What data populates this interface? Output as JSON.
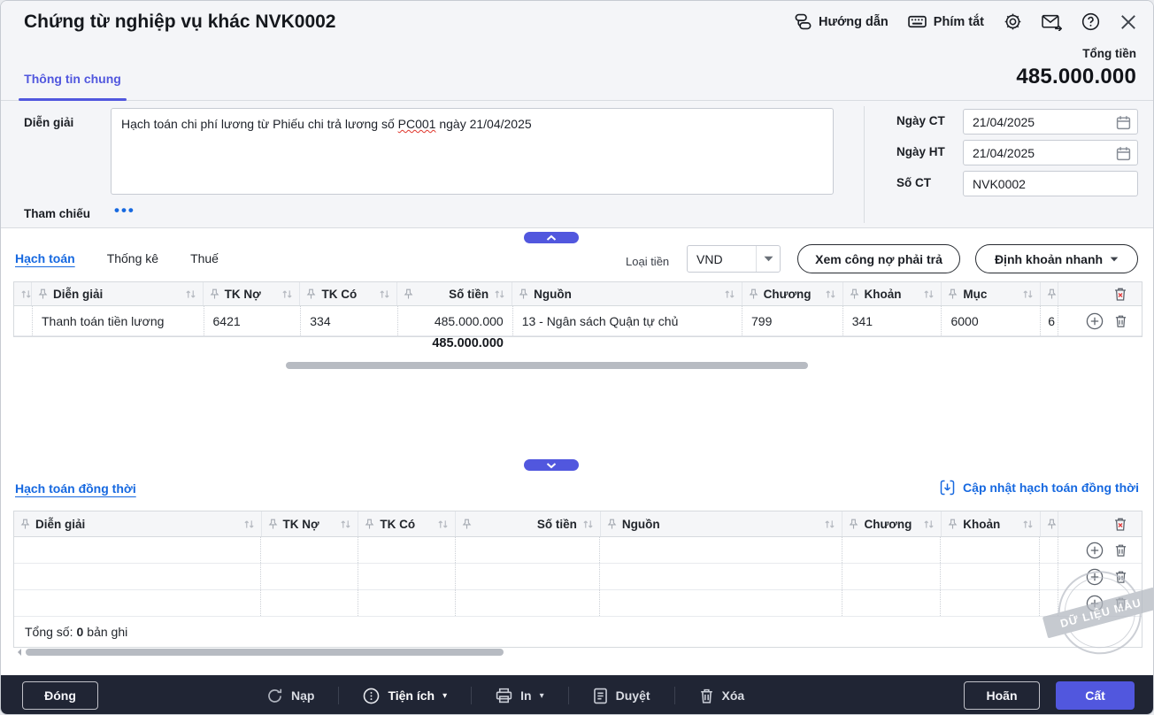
{
  "window": {
    "title": "Chứng từ nghiệp vụ khác NVK0002"
  },
  "header": {
    "guide": "Hướng dẫn",
    "shortcuts": "Phím tắt",
    "total_label": "Tổng tiền",
    "total_value": "485.000.000",
    "tab_general": "Thông tin chung"
  },
  "form": {
    "description_label": "Diễn giải",
    "description_before": "Hạch toán chi phí lương từ Phiếu chi trả lương số ",
    "description_highlight": "PC001",
    "description_after": " ngày 21/04/2025",
    "reference_label": "Tham chiếu",
    "reference_dots": "•••",
    "doc_date_label": "Ngày CT",
    "doc_date_value": "21/04/2025",
    "post_date_label": "Ngày HT",
    "post_date_value": "21/04/2025",
    "doc_no_label": "Số CT",
    "doc_no_value": "NVK0002"
  },
  "detail": {
    "tabs": [
      {
        "label": "Hạch toán"
      },
      {
        "label": "Thống kê"
      },
      {
        "label": "Thuế"
      }
    ],
    "currency_label": "Loại tiền",
    "currency_value": "VND",
    "debt_button": "Xem công nợ phải trả",
    "quick_entry_button": "Định khoản nhanh"
  },
  "table1": {
    "columns": [
      "Diễn giải",
      "TK Nợ",
      "TK Có",
      "Số tiền",
      "Nguồn",
      "Chương",
      "Khoản",
      "Mục"
    ],
    "rows": [
      [
        "Thanh toán tiền lương",
        "6421",
        "334",
        "485.000.000",
        "13 - Ngân sách Quận tự chủ",
        "799",
        "341",
        "6000",
        "6"
      ]
    ],
    "total": "485.000.000"
  },
  "section2": {
    "title": "Hạch toán đồng thời",
    "update_link": "Cập nhật hạch toán đồng thời",
    "columns": [
      "Diễn giải",
      "TK Nợ",
      "TK Có",
      "Số tiền",
      "Nguồn",
      "Chương",
      "Khoản"
    ],
    "summary_label": "Tổng số:",
    "summary_count": "0",
    "summary_suffix": "bản ghi"
  },
  "watermark": "DỮ LIỆU MẪU",
  "footer": {
    "close": "Đóng",
    "reload": "Nạp",
    "utilities": "Tiện ích",
    "print": "In",
    "approve": "Duyệt",
    "delete": "Xóa",
    "postpone": "Hoãn",
    "save": "Cất"
  }
}
